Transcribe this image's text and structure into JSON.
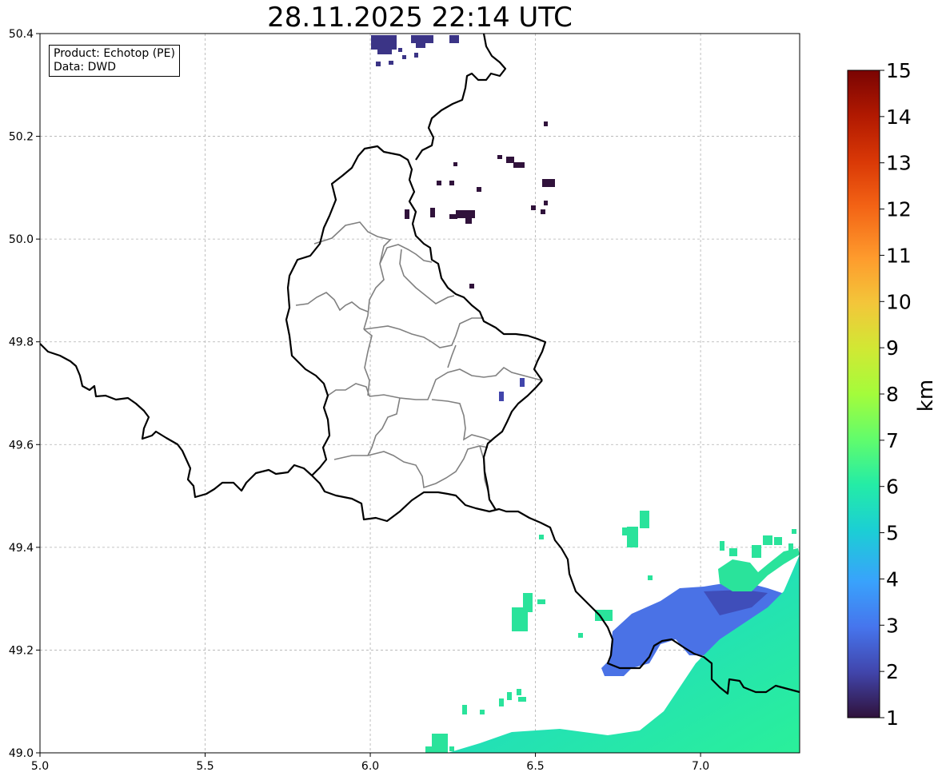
{
  "title": "28.11.2025 22:14 UTC",
  "infobox": {
    "product": "Product: Echotop (PE)",
    "data": "Data: DWD"
  },
  "map": {
    "lon_range": [
      5.0,
      7.3
    ],
    "lat_range": [
      49.0,
      50.4
    ],
    "x_ticks": [
      "5.0",
      "5.5",
      "6.0",
      "6.5",
      "7.0"
    ],
    "x_tick_values": [
      5.0,
      5.5,
      6.0,
      6.5,
      7.0
    ],
    "y_ticks": [
      "49.0",
      "49.2",
      "49.4",
      "49.6",
      "49.8",
      "50.0",
      "50.2",
      "50.4"
    ],
    "y_tick_values": [
      49.0,
      49.2,
      49.4,
      49.6,
      49.8,
      50.0,
      50.2,
      50.4
    ],
    "grid": true,
    "border_color": "#000000",
    "district_color": "#808080",
    "radar_echoes": [
      {
        "lon": 6.04,
        "lat": 50.38,
        "top_km": 2.0
      },
      {
        "lon": 6.15,
        "lat": 50.385,
        "top_km": 2.0
      },
      {
        "lon": 6.26,
        "lat": 50.385,
        "top_km": 2.0
      },
      {
        "lon": 6.53,
        "lat": 50.225,
        "top_km": 1.0
      },
      {
        "lon": 6.43,
        "lat": 50.155,
        "top_km": 1.0
      },
      {
        "lon": 6.54,
        "lat": 50.11,
        "top_km": 1.0
      },
      {
        "lon": 6.29,
        "lat": 50.05,
        "top_km": 1.0
      },
      {
        "lon": 6.19,
        "lat": 50.055,
        "top_km": 1.0
      },
      {
        "lon": 6.12,
        "lat": 50.05,
        "top_km": 1.0
      },
      {
        "lon": 6.5,
        "lat": 50.06,
        "top_km": 1.0
      },
      {
        "lon": 6.3,
        "lat": 49.91,
        "top_km": 1.0
      },
      {
        "lon": 6.45,
        "lat": 49.72,
        "top_km": 2.5
      },
      {
        "lon": 6.39,
        "lat": 49.7,
        "top_km": 2.0
      },
      {
        "lon": 6.81,
        "lat": 49.44,
        "top_km": 5.5
      },
      {
        "lon": 6.45,
        "lat": 49.27,
        "top_km": 6.0
      },
      {
        "lon": 6.88,
        "lat": 49.24,
        "top_km": 3.0
      },
      {
        "lon": 7.08,
        "lat": 49.33,
        "top_km": 6.5
      },
      {
        "lon": 7.25,
        "lat": 49.28,
        "top_km": 5.0
      },
      {
        "lon": 7.15,
        "lat": 49.12,
        "top_km": 5.5
      },
      {
        "lon": 7.1,
        "lat": 49.02,
        "top_km": 6.0
      },
      {
        "lon": 6.6,
        "lat": 49.02,
        "top_km": 6.0
      }
    ]
  },
  "colorbar": {
    "label": "km",
    "ticks": [
      "1",
      "2",
      "3",
      "4",
      "5",
      "6",
      "7",
      "8",
      "9",
      "10",
      "11",
      "12",
      "13",
      "14",
      "15"
    ],
    "min": 1,
    "max": 15,
    "colors": [
      "#30123b",
      "#4145ab",
      "#4675ed",
      "#39a2fc",
      "#1bcfd4",
      "#24eca6",
      "#61fc6c",
      "#a4fc3b",
      "#d1e834",
      "#f3c63a",
      "#fe9b2d",
      "#f36315",
      "#d93806",
      "#b11901",
      "#7a0402"
    ]
  }
}
